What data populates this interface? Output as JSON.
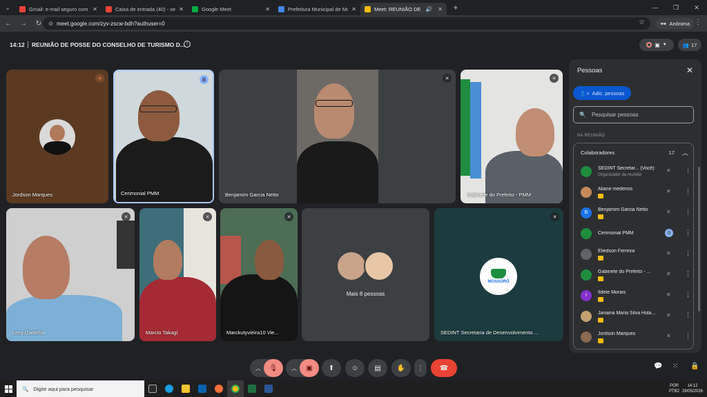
{
  "browser": {
    "tabs": [
      {
        "title": "Gmail: e-mail seguro com tecn",
        "icon": "gmail-icon",
        "color": "#ea4335"
      },
      {
        "title": "Caixa de entrada (40) - sedintê",
        "icon": "gmail-icon",
        "color": "#ea4335"
      },
      {
        "title": "Google Meet",
        "icon": "meet-icon",
        "color": "#00ac47"
      },
      {
        "title": "Prefeitura Municipal de Mossoro",
        "icon": "doc-icon",
        "color": "#4285f4"
      },
      {
        "title": "Meet: REUNIÃO DE POSSE D",
        "icon": "meet-icon",
        "color": "#fbbc04"
      }
    ],
    "url": "meet.google.com/zyv-zscw-bdh?authuser=0",
    "profile_label": "Anônima"
  },
  "meeting": {
    "time": "14:12",
    "title": "REUNIÃO DE POSSE DO CONSELHO DE TURISMO D...",
    "participant_count": "17"
  },
  "tiles": [
    {
      "name": "Jordson Marques"
    },
    {
      "name": "Cerimonial PMM"
    },
    {
      "name": "Benjamim Garcia Netto"
    },
    {
      "name": "Gabinete do Prefeito - PMM"
    },
    {
      "name": "Lecy Gadelha"
    },
    {
      "name": "Marcio Takagi"
    },
    {
      "name": "Marckutyvieira10 Vie..."
    },
    {
      "name": "Mais 8 pessoas"
    },
    {
      "name": "SEDINT Secretaria de Desenvolvimento ..."
    }
  ],
  "logo_text": "MOSSORÓ",
  "people_panel": {
    "title": "Pessoas",
    "add_label": "Adic. pessoas",
    "search_placeholder": "Pesquisar pessoas",
    "section_label": "NA REUNIÃO",
    "group_label": "Colaboradores",
    "group_count": "17",
    "people": [
      {
        "name": "SEDINT Secretar...",
        "you": "(Você)",
        "sub": "Organizador da reunião",
        "avatar_color": "#1e8e3e",
        "initial": ""
      },
      {
        "name": "Aliane medeiros",
        "avatar_color": "#c58a5a",
        "initial": ""
      },
      {
        "name": "Benjamim Garcia Netto",
        "avatar_color": "#1a73e8",
        "initial": "B"
      },
      {
        "name": "Cerimonial PMM",
        "avatar_color": "#1e8e3e",
        "initial": ""
      },
      {
        "name": "Eliedson Ferreira",
        "avatar_color": "#5f6368",
        "initial": ""
      },
      {
        "name": "Gabinete do Prefeito - ...",
        "avatar_color": "#1e8e3e",
        "initial": ""
      },
      {
        "name": "Ildete Morais",
        "avatar_color": "#8430ce",
        "initial": "I"
      },
      {
        "name": "Janaina Maria Silva Hola...",
        "avatar_color": "#c5a070",
        "initial": ""
      },
      {
        "name": "Jordson Marques",
        "avatar_color": "#8a6a50",
        "initial": ""
      }
    ]
  },
  "taskbar": {
    "search_placeholder": "Digite aqui para pesquisar",
    "lang": "POR",
    "lang2": "PTB2",
    "time": "14:12",
    "date": "29/05/2026"
  }
}
